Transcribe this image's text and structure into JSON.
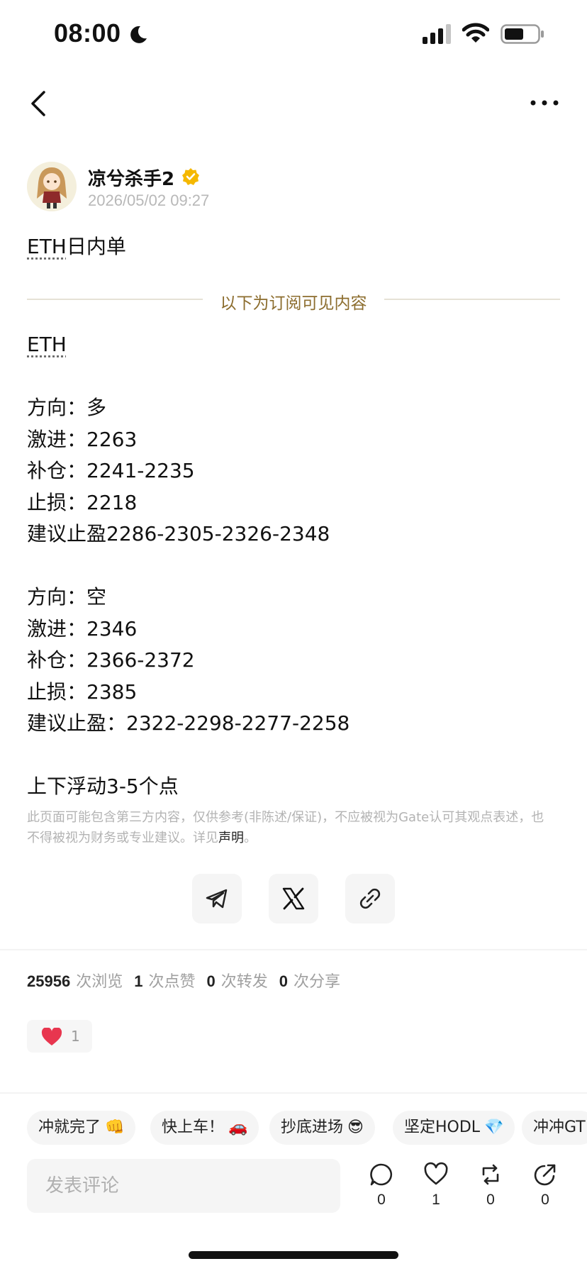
{
  "status_bar": {
    "time": "08:00",
    "icons": [
      "moon-icon",
      "signal-icon",
      "wifi-icon",
      "battery-icon"
    ]
  },
  "nav": {
    "back_icon": "chevron-left-icon",
    "more_icon": "more-horizontal-icon"
  },
  "author": {
    "name": "凉兮杀手2",
    "post_time": "2026/05/02 09:27",
    "badge_icon": "verified-icon",
    "badge_color": "#f5b800"
  },
  "post": {
    "title_ticker": "ETH",
    "title_rest": "日内单",
    "divider_text": "以下为订阅可见内容",
    "ticker": "ETH",
    "long": {
      "direction": "方向：多",
      "aggressive": "激进：2263",
      "add_position": "补仓：2241-2235",
      "stop_loss": "止损：2218",
      "take_profit": "建议止盈2286-2305-2326-2348"
    },
    "short": {
      "direction": "方向：空",
      "aggressive": "激进：2346",
      "add_position": "补仓：2366-2372",
      "stop_loss": "止损：2385",
      "take_profit": "建议止盈：2322-2298-2277-2258"
    },
    "note": "上下浮动3-5个点"
  },
  "disclaimer": {
    "text": "此页面可能包含第三方内容，仅供参考(非陈述/保证)，不应被视为Gate认可其观点表述，也不得被视为财务或专业建议。详见",
    "link": "声明",
    "end": "。"
  },
  "share": [
    "telegram-icon",
    "x-icon",
    "link-icon"
  ],
  "stats": {
    "views": "25956",
    "views_label": "次浏览",
    "likes": "1",
    "likes_label": "次点赞",
    "reposts": "0",
    "reposts_label": "次转发",
    "shares": "0",
    "shares_label": "次分享"
  },
  "reaction": {
    "icon": "heart-icon",
    "count": "1",
    "color": "#e8364f"
  },
  "quick_replies": [
    {
      "text": "冲就完了",
      "emoji": "👊"
    },
    {
      "text": "快上车！",
      "emoji": "🚗"
    },
    {
      "text": "抄底进场",
      "emoji": "😎"
    },
    {
      "text": "坚定HODL",
      "emoji": "💎"
    },
    {
      "text": "冲冲GT",
      "emoji": ""
    }
  ],
  "comment": {
    "placeholder": "发表评论"
  },
  "actions": {
    "comment_count": "0",
    "like_count": "1",
    "repost_count": "0",
    "share_count": "0"
  },
  "colors": {
    "accent": "#8c6d2e",
    "divider": "#e6e2d6",
    "muted": "#b3b3b3"
  }
}
